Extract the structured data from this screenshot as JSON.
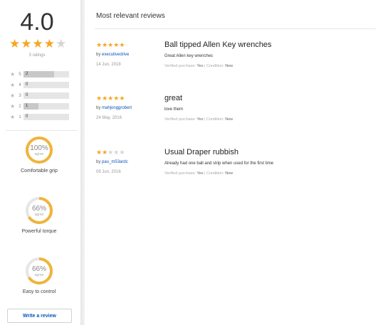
{
  "summary": {
    "average": "4.0",
    "stars": [
      1,
      1,
      1,
      1,
      0
    ],
    "ratings_count": "3 ratings",
    "histogram": [
      {
        "star": "5",
        "count": "2",
        "fraction": 0.67
      },
      {
        "star": "4",
        "count": "0",
        "fraction": 0
      },
      {
        "star": "3",
        "count": "0",
        "fraction": 0
      },
      {
        "star": "2",
        "count": "1",
        "fraction": 0.33
      },
      {
        "star": "1",
        "count": "0",
        "fraction": 0
      }
    ]
  },
  "attributes": [
    {
      "percent": "100%",
      "agree": "agree",
      "label": "Comfortable grip",
      "fraction": 1.0
    },
    {
      "percent": "66%",
      "agree": "agree",
      "label": "Powerful torque",
      "fraction": 0.66
    },
    {
      "percent": "66%",
      "agree": "agree",
      "label": "Easy to control",
      "fraction": 0.66
    }
  ],
  "write_review_label": "Write a review",
  "section_title": "Most relevant reviews",
  "reviews": [
    {
      "stars": [
        1,
        1,
        1,
        1,
        1
      ],
      "by_prefix": "by",
      "author": "executivedrive",
      "date": "14 Jun, 2018",
      "title": "Ball tipped Allen Key wrenches",
      "body": "Great Allen key wrenches",
      "meta_prefix": "Verified purchase:",
      "meta_purchase": "Yes",
      "meta_cond_prefix": "| Condition:",
      "meta_condition": "New"
    },
    {
      "stars": [
        1,
        1,
        1,
        1,
        1
      ],
      "by_prefix": "by",
      "author": "mahjonggrobert",
      "date": "24 May, 2016",
      "title": "great",
      "body": "love them",
      "meta_prefix": "Verified purchase:",
      "meta_purchase": "Yes",
      "meta_cond_prefix": "| Condition:",
      "meta_condition": "New"
    },
    {
      "stars": [
        1,
        1,
        0,
        0,
        0
      ],
      "by_prefix": "by",
      "author": "pau_m53ardc",
      "date": "09 Jun, 2016",
      "title": "Usual Draper rubbish",
      "body": "Already had one ball and strip when used for the first time",
      "meta_prefix": "Verified purchase:",
      "meta_purchase": "Yes",
      "meta_cond_prefix": "| Condition:",
      "meta_condition": "New"
    }
  ],
  "colors": {
    "star_on": "#f5a623",
    "star_off": "#d4d4d4",
    "gauge_track": "#e6e6e6",
    "link": "#0654ba"
  },
  "icons": {
    "star": "star-icon"
  }
}
